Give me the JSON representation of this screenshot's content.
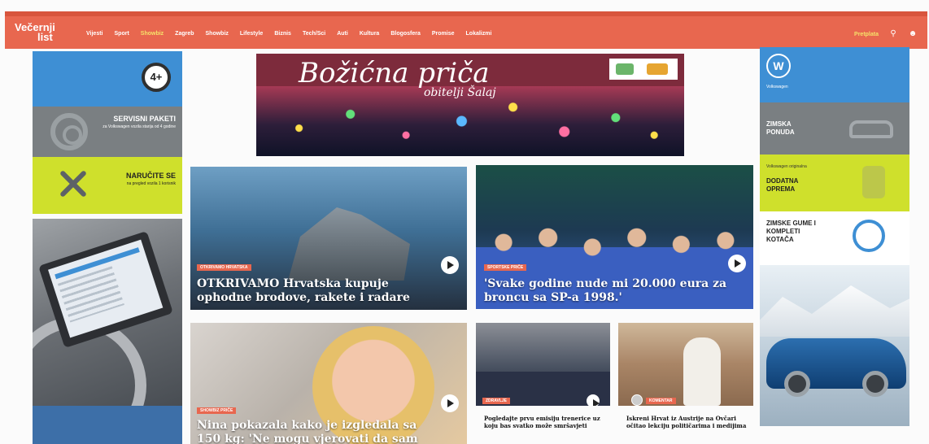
{
  "nav": {
    "logo_line1": "Večernji",
    "logo_line2": "list",
    "links": [
      "Vijesti",
      "Sport",
      "Showbiz",
      "Zagreb",
      "Showbiz",
      "Lifestyle",
      "Biznis",
      "Tech/Sci",
      "Auti",
      "Kultura",
      "Blogosfera",
      "Promise",
      "Lokalizmi"
    ],
    "active_index": 2,
    "right_label": "Pretplata",
    "icons": [
      "search-icon",
      "user-icon"
    ]
  },
  "left_ad": {
    "badge": "4+",
    "box2_title": "SERVISNI PAKETI",
    "box2_sub": "za Volkswagen vozila starija od 4 godine",
    "box3_title": "NARUČITE SE",
    "box3_sub": "na pregled vozila 1 korisnik"
  },
  "right_ad": {
    "brand": "W",
    "brand_sub": "Volkswagen",
    "box2_title": "ZIMSKA PONUDA",
    "box3_pre": "Volkswagen originalna",
    "box3_title": "DODATNA OPREMA",
    "box4_title": "ZIMSKE GUME I KOMPLETI KOTAČA"
  },
  "banner": {
    "title": "Božićna priča",
    "subtitle": "obitelji Šalaj"
  },
  "cards": [
    {
      "tag": "OTKRIVAMO HRVATSKA",
      "title": "OTKRIVAMO Hrvatska kupuje ophodne brodove, rakete i radare"
    },
    {
      "tag": "SPORTSKE PRIČE",
      "title": "'Svake godine nude mi 20.000 eura za broncu sa SP-a 1998.'"
    },
    {
      "tag": "SHOWBIZ PRIČE",
      "title": "Nina pokazala kako je izgledala sa 150 kg: 'Ne mogu vjerovati da sam"
    },
    {
      "tag": "ZDRAVLJE",
      "title": "Pogledajte prvu emisiju trenerice uz koju bas svatko može smršavjeti"
    },
    {
      "tag": "KOMENTAR",
      "title": "Iskreni Hrvat iz Austrije na Ovčari očitao lekciju političarima i medijima"
    }
  ]
}
